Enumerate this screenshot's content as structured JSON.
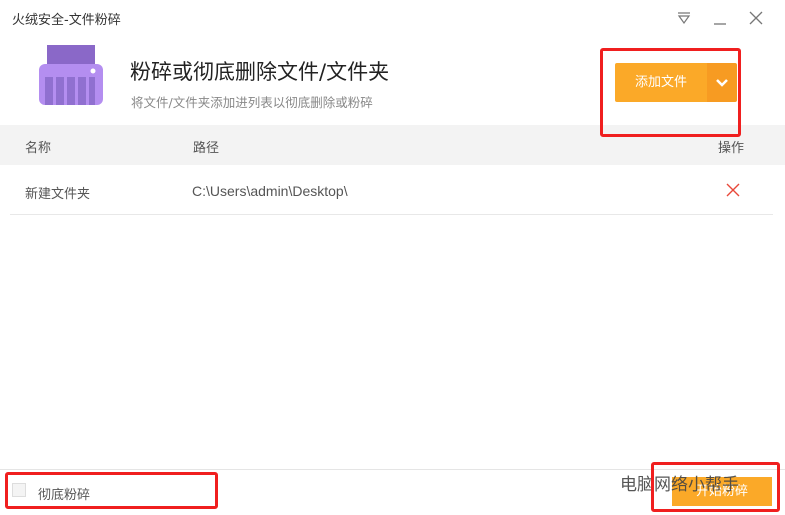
{
  "window": {
    "title": "火绒安全-文件粉碎"
  },
  "header": {
    "heading": "粉碎或彻底删除文件/文件夹",
    "subtitle": "将文件/文件夹添加进列表以彻底删除或粉碎",
    "add_button": "添加文件"
  },
  "table": {
    "columns": [
      "名称",
      "路径",
      "操作"
    ],
    "rows": [
      {
        "name": "新建文件夹",
        "path": "C:\\Users\\admin\\Desktop\\"
      }
    ]
  },
  "footer": {
    "checkbox_label": "彻底粉碎",
    "checked": false,
    "start_button": "开始粉碎"
  },
  "watermark": "电脑网络小帮手",
  "colors": {
    "accent": "#fba928",
    "accent_dark": "#f79b22",
    "delete": "#e8483a",
    "annotation": "#f01f1f"
  }
}
